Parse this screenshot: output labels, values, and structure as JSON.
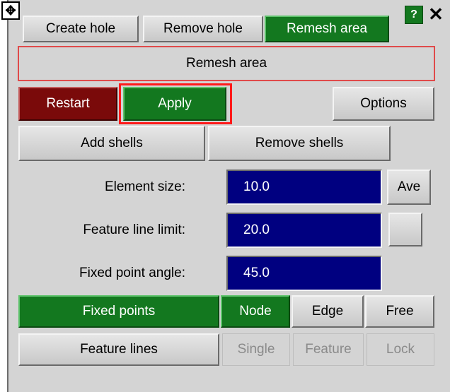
{
  "tabs": [
    {
      "label": "Create hole",
      "active": false
    },
    {
      "label": "Remove hole",
      "active": false
    },
    {
      "label": "Remesh area",
      "active": true
    }
  ],
  "window_controls": {
    "help": "?",
    "close": "✕",
    "move": "✥"
  },
  "title": "Remesh area",
  "actions": {
    "restart": "Restart",
    "apply": "Apply",
    "options": "Options"
  },
  "shells": {
    "add": "Add shells",
    "remove": "Remove shells"
  },
  "params": {
    "element_size": {
      "label": "Element size:",
      "value": "10.0",
      "button": "Ave"
    },
    "feature_line_limit": {
      "label": "Feature line limit:",
      "value": "20.0",
      "button": ""
    },
    "fixed_point_angle": {
      "label": "Fixed point angle:",
      "value": "45.0"
    }
  },
  "fixed_points": {
    "label": "Fixed points",
    "modes": [
      "Node",
      "Edge",
      "Free"
    ],
    "selected": "Node"
  },
  "feature_lines": {
    "label": "Feature lines",
    "modes": [
      "Single",
      "Feature",
      "Lock"
    ],
    "enabled": false
  },
  "colors": {
    "accent_green": "#13781f",
    "field_blue": "#000080",
    "restart_red": "#7a0a0a",
    "highlight_red": "#ff1a1a"
  }
}
